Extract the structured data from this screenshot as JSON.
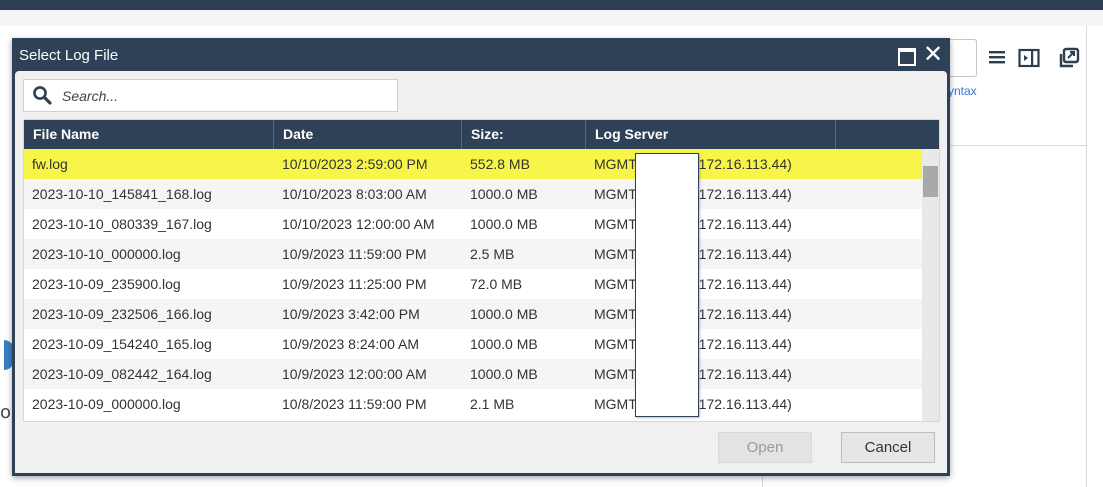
{
  "background": {
    "syntax_link": "yntax",
    "partial_letter": "o",
    "icons": [
      "list-icon",
      "split-view-icon",
      "popout-icon"
    ]
  },
  "dialog": {
    "title": "Select Log File",
    "search": {
      "placeholder": "Search...",
      "value": ""
    },
    "columns": [
      "File Name",
      "Date",
      "Size:",
      "Log Server"
    ],
    "rows": [
      {
        "file": "fw.log",
        "date": "10/10/2023 2:59:00 PM",
        "size": "552.8 MB",
        "server_prefix": "MGMT",
        "server_ip": "(172.16.113.44)"
      },
      {
        "file": "2023-10-10_145841_168.log",
        "date": "10/10/2023 8:03:00 AM",
        "size": "1000.0 MB",
        "server_prefix": "MGMT",
        "server_ip": "(172.16.113.44)"
      },
      {
        "file": "2023-10-10_080339_167.log",
        "date": "10/10/2023 12:00:00 AM",
        "size": "1000.0 MB",
        "server_prefix": "MGMT",
        "server_ip": "(172.16.113.44)"
      },
      {
        "file": "2023-10-10_000000.log",
        "date": "10/9/2023 11:59:00 PM",
        "size": "2.5 MB",
        "server_prefix": "MGMT",
        "server_ip": "(172.16.113.44)"
      },
      {
        "file": "2023-10-09_235900.log",
        "date": "10/9/2023 11:25:00 PM",
        "size": "72.0 MB",
        "server_prefix": "MGMT",
        "server_ip": "(172.16.113.44)"
      },
      {
        "file": "2023-10-09_232506_166.log",
        "date": "10/9/2023 3:42:00 PM",
        "size": "1000.0 MB",
        "server_prefix": "MGMT",
        "server_ip": "(172.16.113.44)"
      },
      {
        "file": "2023-10-09_154240_165.log",
        "date": "10/9/2023 8:24:00 AM",
        "size": "1000.0 MB",
        "server_prefix": "MGMT",
        "server_ip": "(172.16.113.44)"
      },
      {
        "file": "2023-10-09_082442_164.log",
        "date": "10/9/2023 12:00:00 AM",
        "size": "1000.0 MB",
        "server_prefix": "MGMT",
        "server_ip": "(172.16.113.44)"
      },
      {
        "file": "2023-10-09_000000.log",
        "date": "10/8/2023 11:59:00 PM",
        "size": "2.1 MB",
        "server_prefix": "MGMT",
        "server_ip": "(172.16.113.44)"
      }
    ],
    "selected_row": 0,
    "buttons": {
      "open": "Open",
      "cancel": "Cancel"
    },
    "colors": {
      "header": "#2f4156",
      "selected_row": "#f7f44a"
    }
  }
}
